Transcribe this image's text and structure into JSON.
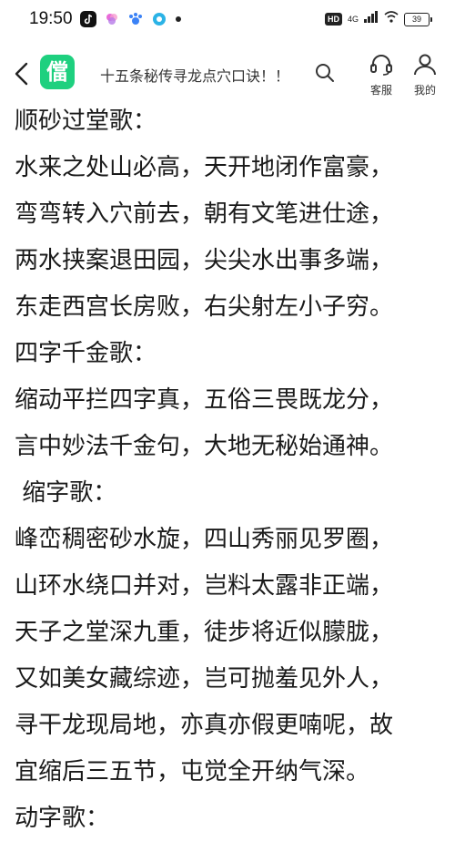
{
  "status_bar": {
    "time": "19:50",
    "hd": "HD",
    "network": "4G",
    "battery": "39",
    "notification_icons": [
      {
        "name": "tiktok-icon",
        "color": "#111111"
      },
      {
        "name": "photos-icon",
        "color": "#e96bd8"
      },
      {
        "name": "paw-icon",
        "color": "#3b82f6"
      },
      {
        "name": "browser-icon",
        "color": "#2bb3e6"
      }
    ]
  },
  "header": {
    "logo_glyph": "儅",
    "title": "十五条秘传寻龙点穴口诀！！",
    "support_label": "客服",
    "mine_label": "我的"
  },
  "content": {
    "lines": [
      "顺砂过堂歌：",
      "水来之处山必高，天开地闭作富豪，",
      "弯弯转入穴前去，朝有文笔进仕途，",
      "两水挟案退田园，尖尖水出事多端，",
      "东走西宫长房败，右尖射左小子穷。",
      "四字千金歌：",
      "缩动平拦四字真，五俗三畏既龙分，",
      "言中妙法千金句，大地无秘始通神。",
      " 缩字歌：",
      "峰峦稠密砂水旋，四山秀丽见罗圈，",
      "山环水绕口并对，岂料太露非正端，",
      "天子之堂深九重，徒步将近似朦胧，",
      "又如美女藏综迹，岂可抛羞见外人，",
      "寻干龙现局地，亦真亦假更喃呢，故",
      "宜缩后三五节，屯觉全开纳气深。",
      "动字歌："
    ]
  },
  "colors": {
    "logo_green": "#1ed07f",
    "text": "#1a1a1a"
  }
}
